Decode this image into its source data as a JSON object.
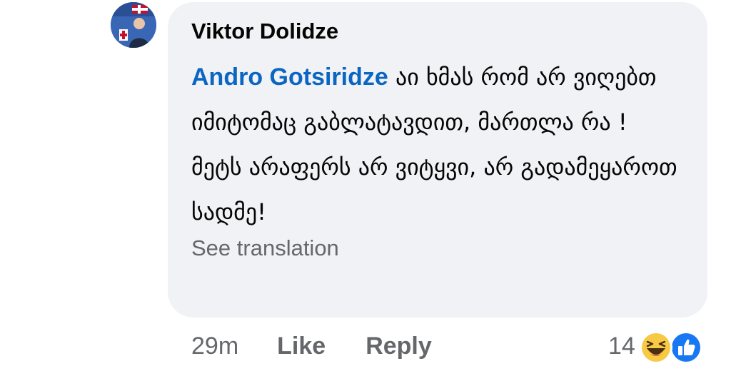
{
  "comment": {
    "author": "Viktor Dolidze",
    "mention": "Andro Gotsiridze",
    "text": "აი ხმას რომ არ ვიღებთ იმიტომაც გაბლატავდით, მართლა რა ! მეტს არაფერს არ ვიტყვი, არ გადამეყაროთ სადმე!",
    "see_translation": "See translation"
  },
  "actions": {
    "time": "29m",
    "like_label": "Like",
    "reply_label": "Reply"
  },
  "reactions": {
    "count": "14",
    "icons": [
      "haha-icon",
      "like-reaction-icon"
    ]
  },
  "colors": {
    "bubble": "#f0f2f5",
    "mention": "#0a66c2",
    "secondary_text": "#65676b",
    "like_blue": "#1877f2",
    "haha_yellow": "#f7c944"
  }
}
